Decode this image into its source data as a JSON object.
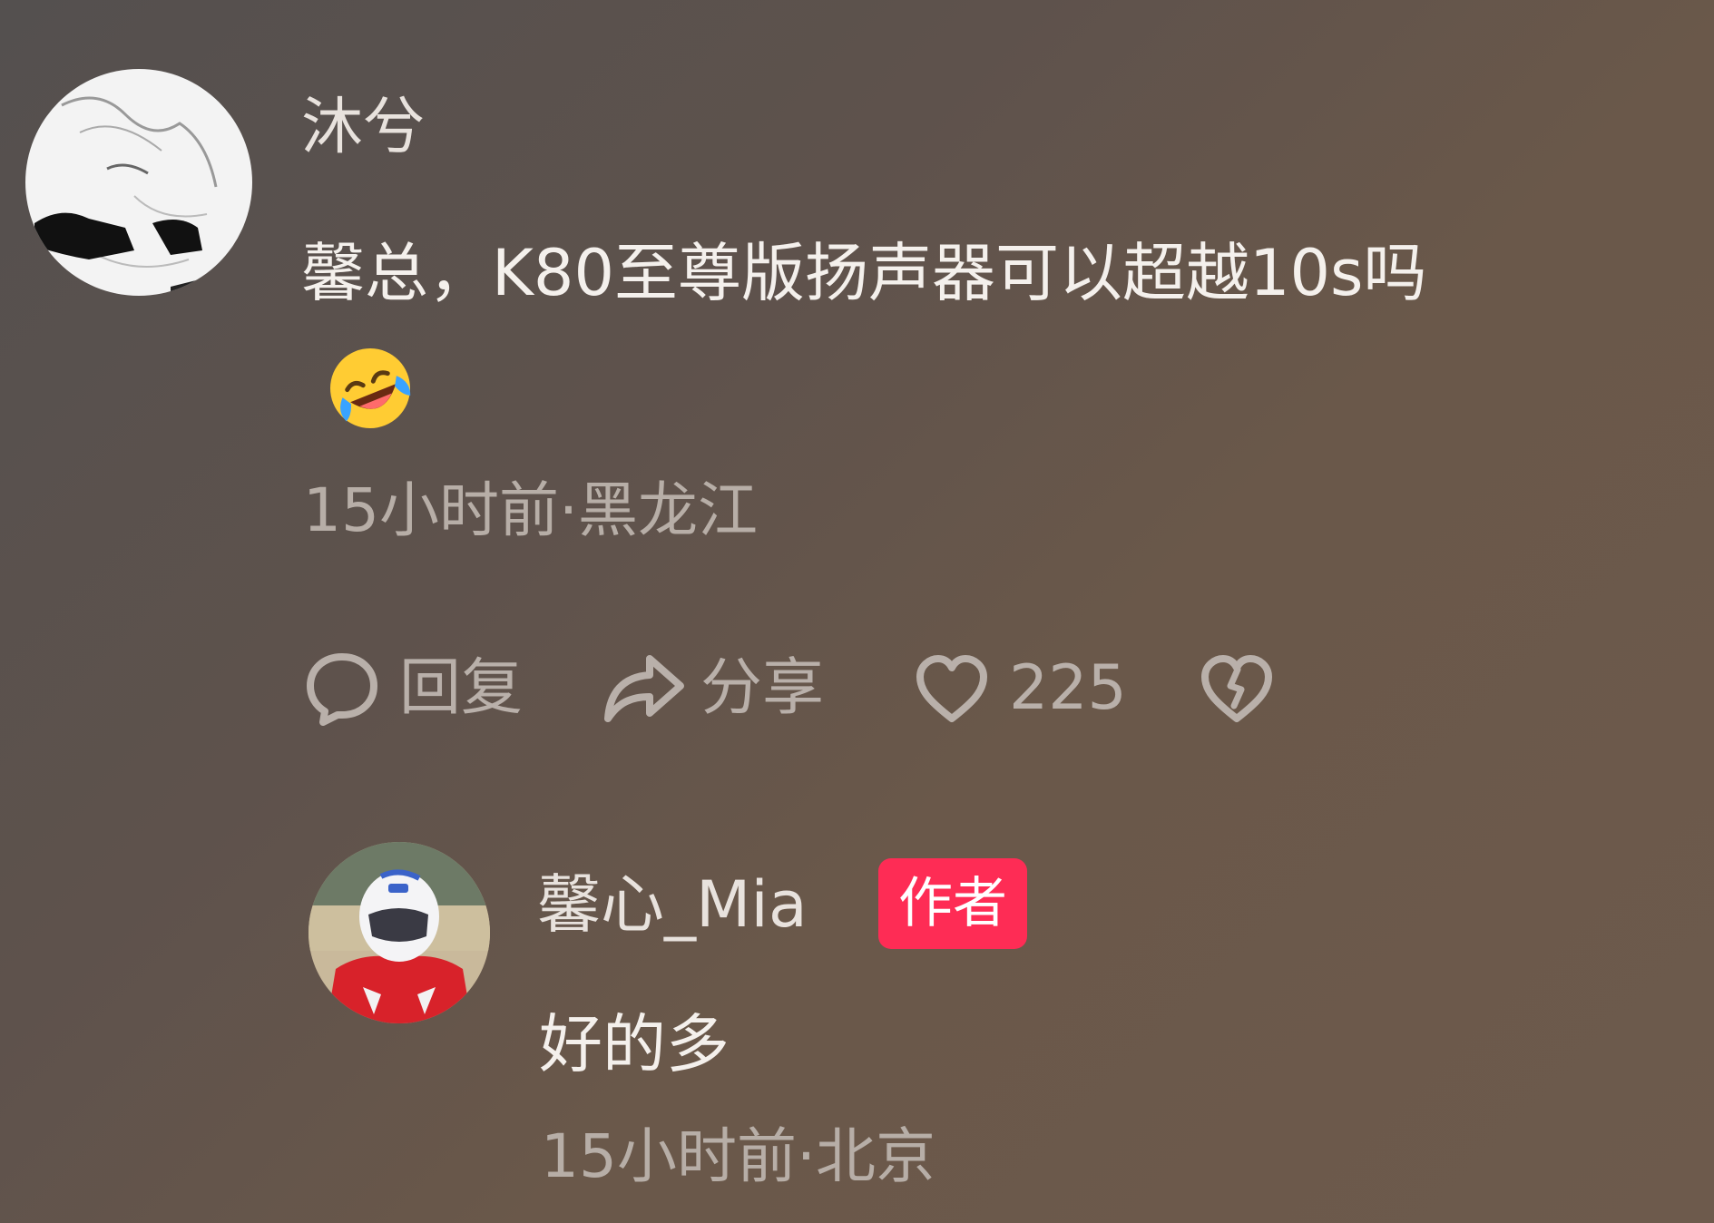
{
  "comment": {
    "username": "沐兮",
    "text": "馨总，K80至尊版扬声器可以超越10s吗",
    "emoji": "rolling-on-floor-laughing",
    "meta": "15小时前·黑龙江",
    "actions": {
      "reply_label": "回复",
      "share_label": "分享",
      "like_count": "225"
    }
  },
  "reply": {
    "username": "馨心_Mia",
    "badge": "作者",
    "text": "好的多",
    "meta": "15小时前·北京"
  },
  "colors": {
    "author_badge": "#fe2c55",
    "action_gray": "#b9b0aa",
    "meta_gray": "#b7aea7"
  },
  "icons": [
    "reply-bubble-icon",
    "share-arrow-icon",
    "heart-icon",
    "broken-heart-icon"
  ]
}
